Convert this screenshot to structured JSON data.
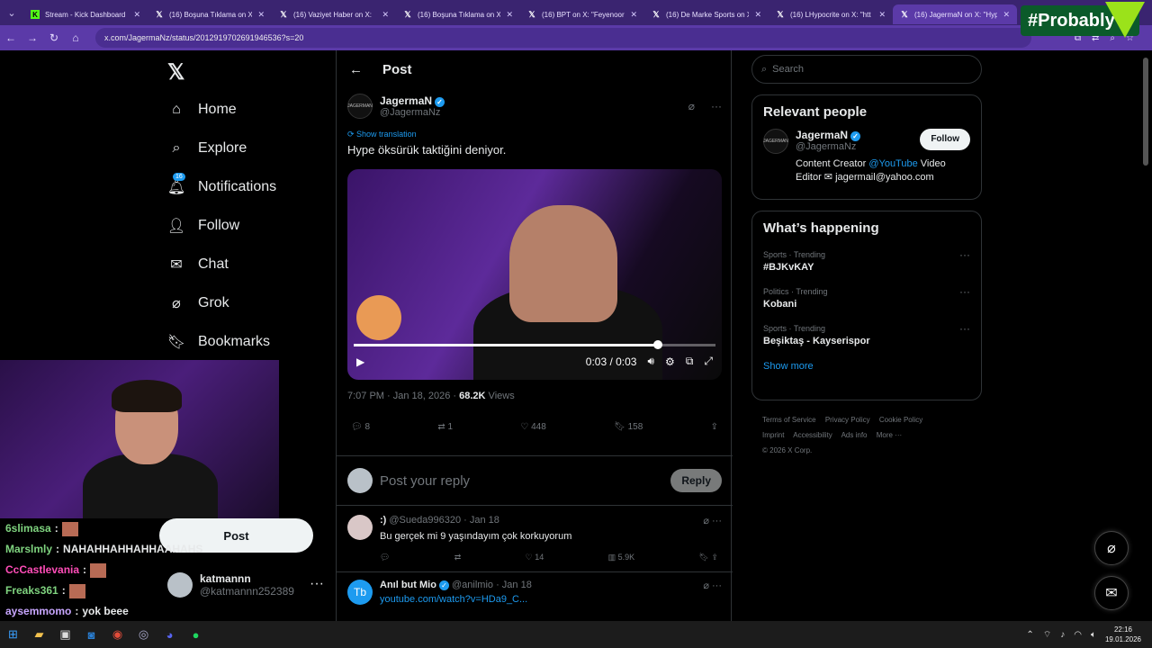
{
  "tabs": [
    {
      "label": "Stream - Kick Dashboard",
      "icon": "kick-icon"
    },
    {
      "label": "(16) Boşuna Tıklama on X",
      "icon": "x-icon"
    },
    {
      "label": "(16) Vaziyet Haber on X: ",
      "icon": "x-icon"
    },
    {
      "label": "(16) Boşuna Tıklama on X",
      "icon": "x-icon"
    },
    {
      "label": "(16) BPT on X: \"Feyenoord",
      "icon": "x-icon"
    },
    {
      "label": "(16) De Marke Sports on X",
      "icon": "x-icon"
    },
    {
      "label": "(16) LHypocrite on X: \"htt",
      "icon": "x-icon"
    },
    {
      "label": "(16) JagermaN on X: \"Hyp",
      "icon": "x-icon"
    }
  ],
  "overlay": {
    "brand": "#Probably"
  },
  "address": {
    "url": "x.com/JagermaNz/status/2012919702691946536?s=20"
  },
  "nav": {
    "home": "Home",
    "explore": "Explore",
    "notifications": "Notifications",
    "notifications_badge": "16",
    "follow": "Follow",
    "chat": "Chat",
    "grok": "Grok",
    "bookmarks": "Bookmarks",
    "post": "Post"
  },
  "account": {
    "name": "katmannn",
    "handle": "@katmannn252389"
  },
  "chat": [
    {
      "user": "6slimasa",
      "color": "#7fd37f",
      "text": ""
    },
    {
      "user": "Marslmly",
      "color": "#7fd37f",
      "text": "NAHAHHAHHAHHAAHAHS"
    },
    {
      "user": "CcCastlevania",
      "color": "#ff4db8",
      "text": ""
    },
    {
      "user": "Freaks361",
      "color": "#7fd37f",
      "text": ""
    },
    {
      "user": "aysemmomo",
      "color": "#c8a6ff",
      "text": "yok beee"
    }
  ],
  "main": {
    "header": "Post",
    "author": "JagermaN",
    "handle": "@JagermaNz",
    "show_translation": "Show translation",
    "text": "Hype öksürük taktiğini deniyor.",
    "time": "0:03 / 0:03",
    "progress": 0.84,
    "date": "7:07 PM · Jan 18, 2026 · ",
    "views": "68.2K",
    "views_label": " Views",
    "replies": "8",
    "reposts": "1",
    "likes": "448",
    "bookmarks": "158",
    "reply_placeholder": "Post your reply",
    "reply_button": "Reply"
  },
  "comments": [
    {
      "name": ":)",
      "handle": "@Sueda996320 · Jan 18",
      "text": "Bu gerçek mi 9 yaşındayım çok korkuyorum",
      "likes": "14",
      "views": "5.9K"
    },
    {
      "name": "Anıl but Mio",
      "handle": "@anilmio · Jan 18",
      "text": "youtube.com/watch?v=HDa9_C...",
      "avatar": "Tb"
    }
  ],
  "right": {
    "search_placeholder": "Search",
    "relevant_title": "Relevant people",
    "rel_name": "JagermaN",
    "rel_handle": "@JagermaNz",
    "rel_bio_a": "Content Creator ",
    "rel_bio_link": "@YouTube",
    "rel_bio_b": " Video Editor ✉ jagermail@yahoo.com",
    "follow_button": "Follow",
    "happening_title": "What’s happening",
    "trends": [
      {
        "meta": "Sports · Trending",
        "name": "#BJKvKAY"
      },
      {
        "meta": "Politics · Trending",
        "name": "Kobani"
      },
      {
        "meta": "Sports · Trending",
        "name": "Beşiktaş - Kayserispor"
      }
    ],
    "show_more": "Show more",
    "footer": [
      "Terms of Service",
      "Privacy Policy",
      "Cookie Policy",
      "Imprint",
      "Accessibility",
      "Ads info",
      "More ···",
      "© 2026 X Corp."
    ]
  },
  "taskbar": {
    "time": "22:16",
    "date": "19.01.2026"
  }
}
